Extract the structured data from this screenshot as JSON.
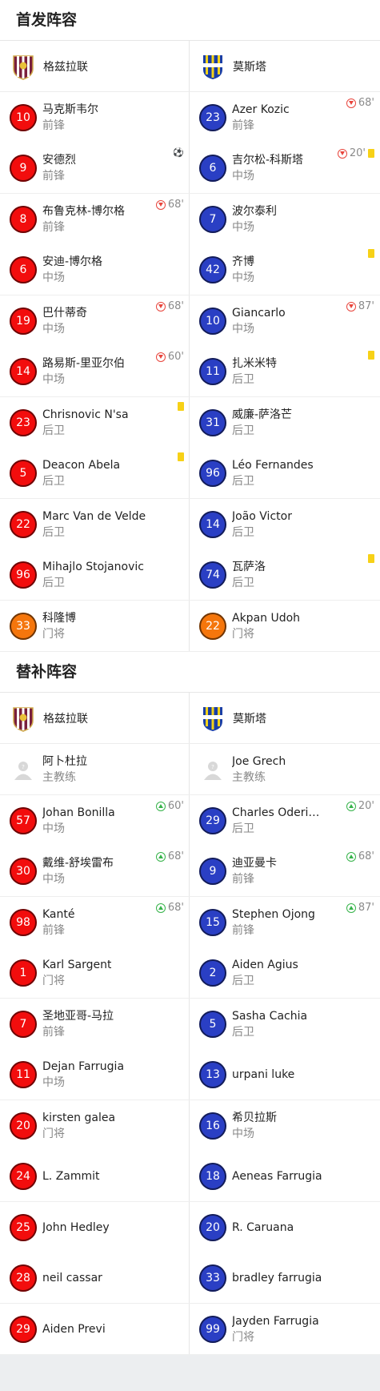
{
  "starting_title": "首发阵容",
  "subs_title": "替补阵容",
  "home_team": "格兹拉联",
  "away_team": "莫斯塔",
  "colors": {
    "home": "#f20d0d",
    "away": "#2a3fc4",
    "goalkeeper": "#f5760c",
    "sub_in": "#36b34a",
    "sub_out": "#e8453c",
    "yellow_card": "#f7d117"
  },
  "starting_rows": [
    {
      "home": {
        "number": "10",
        "name": "马克斯韦尔",
        "position": "前锋",
        "events": []
      },
      "away": {
        "number": "23",
        "name": "Azer Kozic",
        "position": "前锋",
        "events": [
          {
            "type": "sub-out",
            "minute": "68'"
          }
        ]
      }
    },
    {
      "home": {
        "number": "9",
        "name": "安德烈",
        "position": "前锋",
        "events": [
          {
            "type": "goal"
          }
        ]
      },
      "away": {
        "number": "6",
        "name": "吉尔松-科斯塔",
        "position": "中场",
        "events": [
          {
            "type": "sub-out",
            "minute": "20'"
          },
          {
            "type": "yellow"
          }
        ]
      }
    },
    {
      "home": {
        "number": "8",
        "name": "布鲁克林-博尔格",
        "position": "前锋",
        "events": [
          {
            "type": "sub-out",
            "minute": "68'"
          }
        ]
      },
      "away": {
        "number": "7",
        "name": "波尔泰利",
        "position": "中场",
        "events": []
      }
    },
    {
      "home": {
        "number": "6",
        "name": "安迪-博尔格",
        "position": "中场",
        "events": []
      },
      "away": {
        "number": "42",
        "name": "齐博",
        "position": "中场",
        "events": [
          {
            "type": "yellow"
          }
        ]
      }
    },
    {
      "home": {
        "number": "19",
        "name": "巴什蒂奇",
        "position": "中场",
        "events": [
          {
            "type": "sub-out",
            "minute": "68'"
          }
        ]
      },
      "away": {
        "number": "10",
        "name": "Giancarlo",
        "position": "中场",
        "events": [
          {
            "type": "sub-out",
            "minute": "87'"
          }
        ]
      }
    },
    {
      "home": {
        "number": "14",
        "name": "路易斯-里亚尔伯",
        "position": "中场",
        "events": [
          {
            "type": "sub-out",
            "minute": "60'"
          }
        ]
      },
      "away": {
        "number": "11",
        "name": "扎米米特",
        "position": "后卫",
        "events": [
          {
            "type": "yellow"
          }
        ]
      }
    },
    {
      "home": {
        "number": "23",
        "name": "Chrisnovic N'sa",
        "position": "后卫",
        "events": [
          {
            "type": "yellow"
          }
        ]
      },
      "away": {
        "number": "31",
        "name": "威廉-萨洛芒",
        "position": "后卫",
        "events": []
      }
    },
    {
      "home": {
        "number": "5",
        "name": "Deacon Abela",
        "position": "后卫",
        "events": [
          {
            "type": "yellow"
          }
        ]
      },
      "away": {
        "number": "96",
        "name": "Léo Fernandes",
        "position": "后卫",
        "events": []
      }
    },
    {
      "home": {
        "number": "22",
        "name": "Marc Van de Velde",
        "position": "后卫",
        "events": []
      },
      "away": {
        "number": "14",
        "name": "João Victor",
        "position": "后卫",
        "events": []
      }
    },
    {
      "home": {
        "number": "96",
        "name": "Mihajlo Stojanovic",
        "position": "后卫",
        "events": []
      },
      "away": {
        "number": "74",
        "name": "瓦萨洛",
        "position": "后卫",
        "events": [
          {
            "type": "yellow"
          }
        ]
      }
    },
    {
      "home": {
        "number": "33",
        "name": "科隆博",
        "position": "门将",
        "events": [],
        "gk": true
      },
      "away": {
        "number": "22",
        "name": "Akpan Udoh",
        "position": "门将",
        "events": [],
        "gk": true
      }
    }
  ],
  "coaches": {
    "home": {
      "name": "阿卜杜拉",
      "role": "主教练"
    },
    "away": {
      "name": "Joe Grech",
      "role": "主教练"
    }
  },
  "sub_rows": [
    {
      "home": {
        "number": "57",
        "name": "Johan Bonilla",
        "position": "中场",
        "events": [
          {
            "type": "sub-in",
            "minute": "60'"
          }
        ]
      },
      "away": {
        "number": "29",
        "name": "Charles Oderinde",
        "position": "后卫",
        "events": [
          {
            "type": "sub-in",
            "minute": "20'"
          }
        ]
      }
    },
    {
      "home": {
        "number": "30",
        "name": "戴维-舒埃雷布",
        "position": "中场",
        "events": [
          {
            "type": "sub-in",
            "minute": "68'"
          }
        ]
      },
      "away": {
        "number": "9",
        "name": "迪亚曼卡",
        "position": "前锋",
        "events": [
          {
            "type": "sub-in",
            "minute": "68'"
          }
        ]
      }
    },
    {
      "home": {
        "number": "98",
        "name": "Kanté",
        "position": "前锋",
        "events": [
          {
            "type": "sub-in",
            "minute": "68'"
          }
        ]
      },
      "away": {
        "number": "15",
        "name": "Stephen Ojong",
        "position": "前锋",
        "events": [
          {
            "type": "sub-in",
            "minute": "87'"
          }
        ]
      }
    },
    {
      "home": {
        "number": "1",
        "name": "Karl Sargent",
        "position": "门将",
        "events": []
      },
      "away": {
        "number": "2",
        "name": "Aiden Agius",
        "position": "后卫",
        "events": []
      }
    },
    {
      "home": {
        "number": "7",
        "name": "圣地亚哥-马拉",
        "position": "前锋",
        "events": []
      },
      "away": {
        "number": "5",
        "name": "Sasha Cachia",
        "position": "后卫",
        "events": []
      }
    },
    {
      "home": {
        "number": "11",
        "name": "Dejan Farrugia",
        "position": "中场",
        "events": []
      },
      "away": {
        "number": "13",
        "name": "urpani luke",
        "position": "",
        "events": []
      }
    },
    {
      "home": {
        "number": "20",
        "name": "kirsten galea",
        "position": "门将",
        "events": []
      },
      "away": {
        "number": "16",
        "name": "希贝拉斯",
        "position": "中场",
        "events": []
      }
    },
    {
      "home": {
        "number": "24",
        "name": "L. Zammit",
        "position": "",
        "events": []
      },
      "away": {
        "number": "18",
        "name": "Aeneas Farrugia",
        "position": "",
        "events": []
      }
    },
    {
      "home": {
        "number": "25",
        "name": "John Hedley",
        "position": "",
        "events": []
      },
      "away": {
        "number": "20",
        "name": "R. Caruana",
        "position": "",
        "events": []
      }
    },
    {
      "home": {
        "number": "28",
        "name": "neil cassar",
        "position": "",
        "events": []
      },
      "away": {
        "number": "33",
        "name": "bradley farrugia",
        "position": "",
        "events": []
      }
    },
    {
      "home": {
        "number": "29",
        "name": "Aiden Previ",
        "position": "",
        "events": []
      },
      "away": {
        "number": "99",
        "name": "Jayden Farrugia",
        "position": "门将",
        "events": []
      }
    }
  ]
}
